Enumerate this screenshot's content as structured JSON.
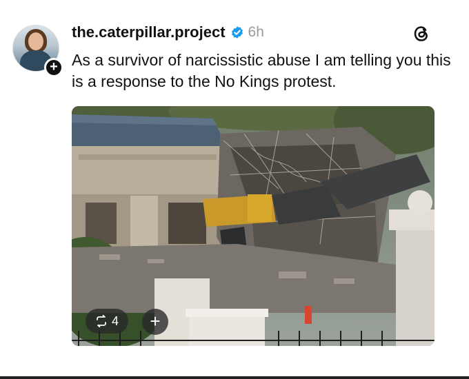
{
  "post": {
    "username": "the.caterpillar.project",
    "time": "6h",
    "text": "As a survivor of narcissistic abuse I am telling you this is a response to the No Kings protest.",
    "verified": true
  },
  "media_controls": {
    "repost_count": "4",
    "add_label": "+"
  },
  "icons": {
    "verified": "verified-badge-icon",
    "threads": "threads-logo-icon",
    "repost": "repost-icon",
    "follow": "plus-icon"
  },
  "colors": {
    "verified_blue": "#1d9bf0",
    "time_gray": "#999999"
  }
}
